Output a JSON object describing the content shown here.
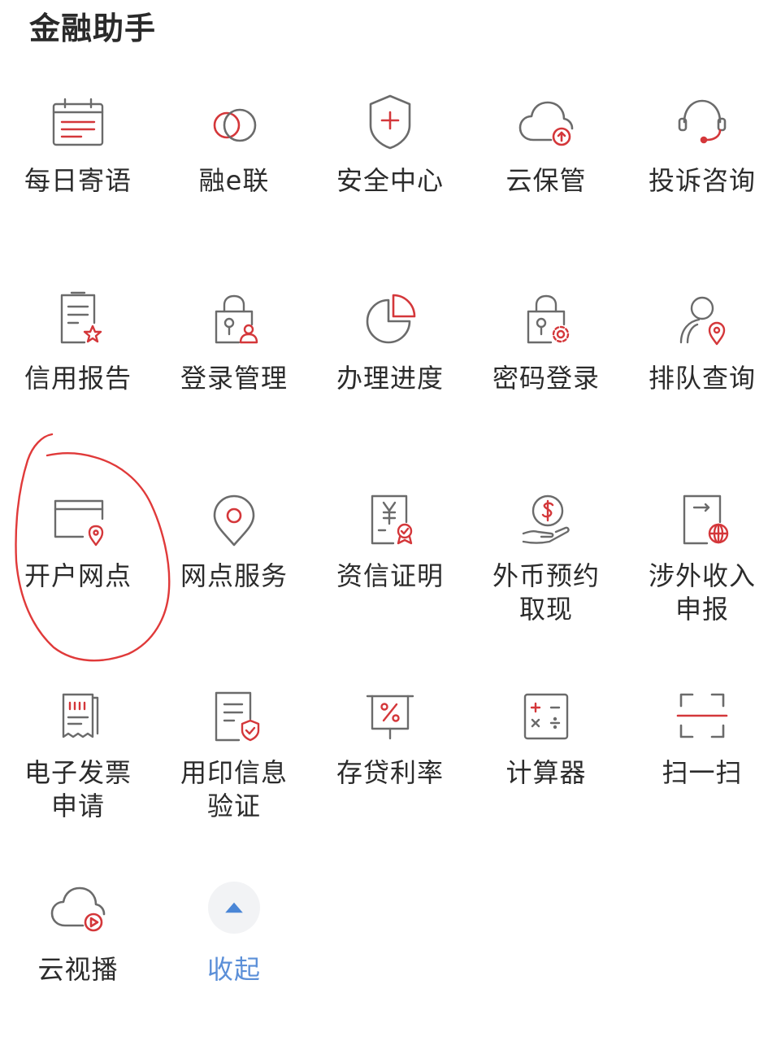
{
  "header": {
    "title": "金融助手"
  },
  "items": {
    "r1": [
      {
        "label": "每日寄语",
        "icon": "calendar-icon"
      },
      {
        "label": "融e联",
        "icon": "chat-link-icon"
      },
      {
        "label": "安全中心",
        "icon": "shield-plus-icon"
      },
      {
        "label": "云保管",
        "icon": "cloud-upload-icon"
      },
      {
        "label": "投诉咨询",
        "icon": "headset-icon"
      }
    ],
    "r2": [
      {
        "label": "信用报告",
        "icon": "report-star-icon"
      },
      {
        "label": "登录管理",
        "icon": "lock-user-icon"
      },
      {
        "label": "办理进度",
        "icon": "pie-progress-icon"
      },
      {
        "label": "密码登录",
        "icon": "lock-gear-icon"
      },
      {
        "label": "排队查询",
        "icon": "person-location-icon"
      }
    ],
    "r3": [
      {
        "label": "开户网点",
        "icon": "card-location-icon"
      },
      {
        "label": "网点服务",
        "icon": "location-pin-icon"
      },
      {
        "label": "资信证明",
        "icon": "yen-certificate-icon"
      },
      {
        "label": "外币预约\n取现",
        "icon": "dollar-hand-icon"
      },
      {
        "label": "涉外收入\n申报",
        "icon": "document-globe-icon"
      }
    ],
    "r4": [
      {
        "label": "电子发票\n申请",
        "icon": "invoice-icon"
      },
      {
        "label": "用印信息\n验证",
        "icon": "document-check-icon"
      },
      {
        "label": "存贷利率",
        "icon": "percent-board-icon"
      },
      {
        "label": "计算器",
        "icon": "calculator-icon"
      },
      {
        "label": "扫一扫",
        "icon": "scan-icon"
      }
    ],
    "r5": [
      {
        "label": "云视播",
        "icon": "cloud-play-icon"
      },
      {
        "label": "收起",
        "icon": "collapse-arrow-icon"
      }
    ]
  },
  "colors": {
    "icon_stroke": "#6b6b6b",
    "accent_red": "#d4373a",
    "collapse_blue": "#5b8fd8",
    "annotation_red": "#e03a3a"
  }
}
